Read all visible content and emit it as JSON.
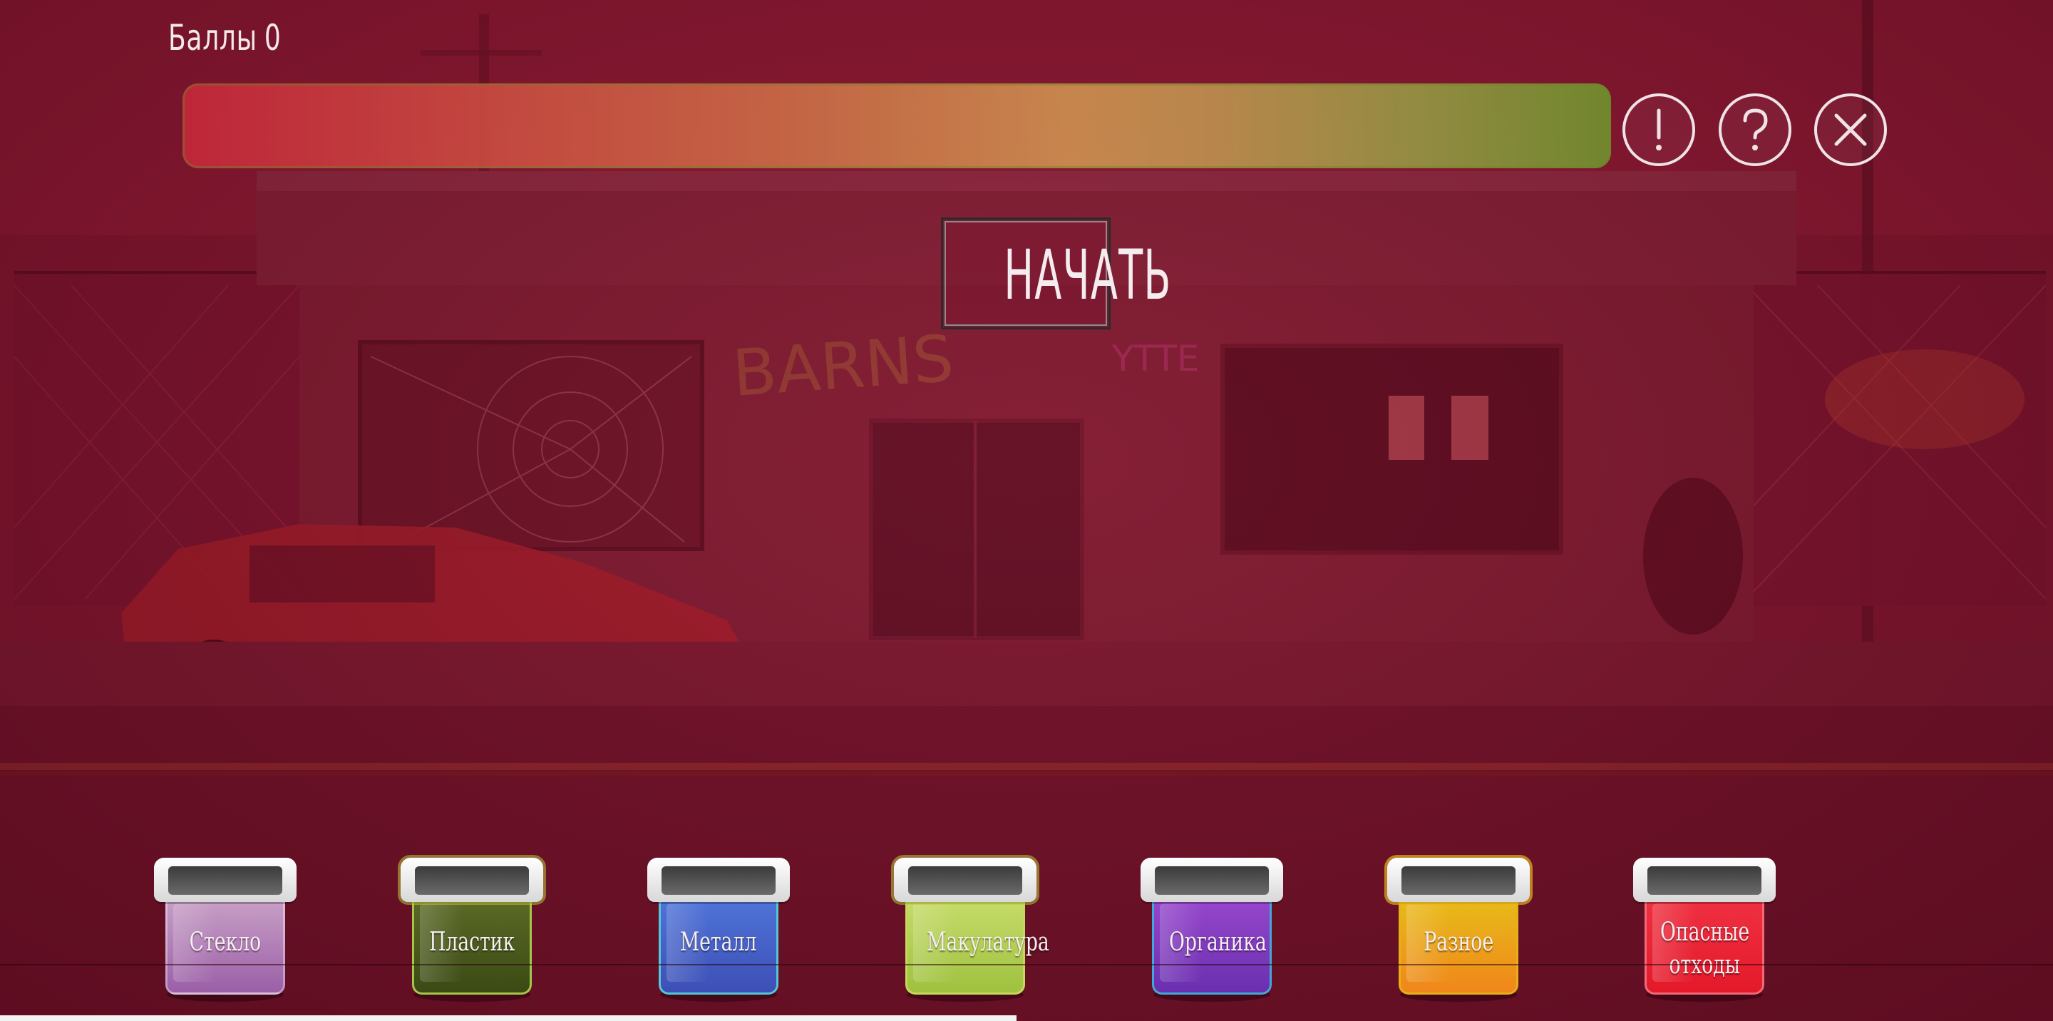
{
  "hud": {
    "score_label": "Баллы",
    "score_value": "0",
    "progress": 1.0
  },
  "buttons": {
    "info_icon": "exclamation-circle-icon",
    "help_icon": "question-circle-icon",
    "close_icon": "close-circle-icon",
    "start_label": "НАЧАТЬ"
  },
  "bins": [
    {
      "id": "glass",
      "label": "Стекло",
      "color": "#9b5fa7"
    },
    {
      "id": "plastic",
      "label": "Пластик",
      "color": "#3b4a14"
    },
    {
      "id": "metal",
      "label": "Металл",
      "color": "#3d4fb6"
    },
    {
      "id": "paper",
      "label": "Макулатура",
      "color": "#9fc13f"
    },
    {
      "id": "organic",
      "label": "Органика",
      "color": "#6a2fb0"
    },
    {
      "id": "misc",
      "label": "Разное",
      "color": "#f0861b"
    },
    {
      "id": "hazard",
      "label_line1": "Опасные",
      "label_line2": "отходы",
      "color": "#e4192a"
    }
  ],
  "colors": {
    "background": "#7f1730",
    "progress_start": "#cb2a3c",
    "progress_end": "#6f9a2e",
    "text": "#f3e8ea"
  }
}
